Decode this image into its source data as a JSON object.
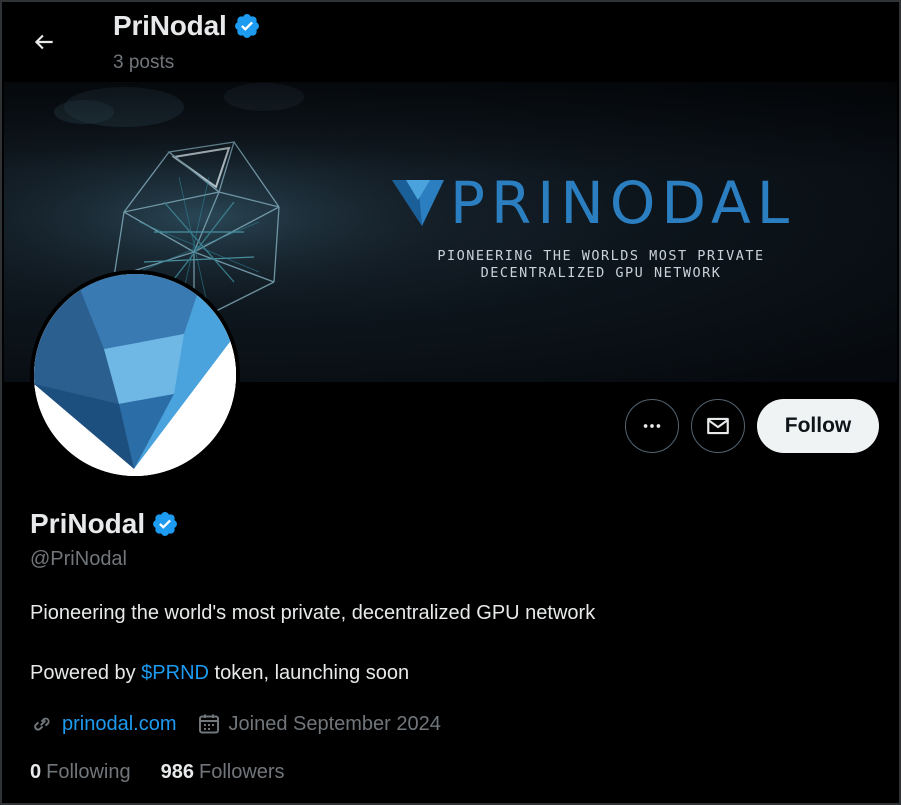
{
  "header": {
    "back_icon": "arrow-left-icon",
    "name": "PriNodal",
    "posts_count": "3 posts",
    "verified_icon": "verified-badge-icon"
  },
  "banner": {
    "brand_word": "PRINODAL",
    "tagline_line1": "PIONEERING THE WORLDS MOST PRIVATE",
    "tagline_line2": "DECENTRALIZED GPU NETWORK"
  },
  "actions": {
    "more_icon": "more-dots-icon",
    "message_icon": "mail-icon",
    "follow_label": "Follow"
  },
  "profile": {
    "name": "PriNodal",
    "handle": "@PriNodal",
    "bio_line1": "Pioneering the world's most private, decentralized GPU network",
    "bio_line2_prefix": "Powered by ",
    "bio_line2_cashtag": "$PRND",
    "bio_line2_suffix": " token, launching soon",
    "website": "prinodal.com",
    "joined": "Joined September 2024",
    "following_count": "0",
    "following_label": "Following",
    "followers_count": "986",
    "followers_label": "Followers"
  },
  "colors": {
    "background": "#000000",
    "accent_blue": "#1d9bf0",
    "muted_text": "#71767b",
    "primary_text": "#e7e9ea",
    "follow_button_bg": "#eff3f4",
    "brand_blue": "#2b7fc0"
  }
}
